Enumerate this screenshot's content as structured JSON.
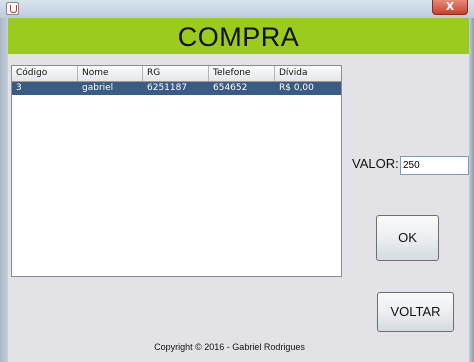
{
  "window": {
    "close_label": "X"
  },
  "header": {
    "title": "COMPRA",
    "band_color": "#9bcb1d"
  },
  "table": {
    "columns": [
      "Código",
      "Nome",
      "RG",
      "Telefone",
      "Dívida"
    ],
    "rows": [
      [
        "3",
        "gabriel",
        "6251187",
        "654652",
        "R$ 0,00"
      ]
    ],
    "selected_row_color": "#3a5b84"
  },
  "form": {
    "valor_label": "VALOR:",
    "valor_value": "250"
  },
  "buttons": {
    "ok_label": "OK",
    "voltar_label": "VOLTAR"
  },
  "footer": {
    "copyright": "Copyright © 2016 - Gabriel Rodrigues"
  }
}
